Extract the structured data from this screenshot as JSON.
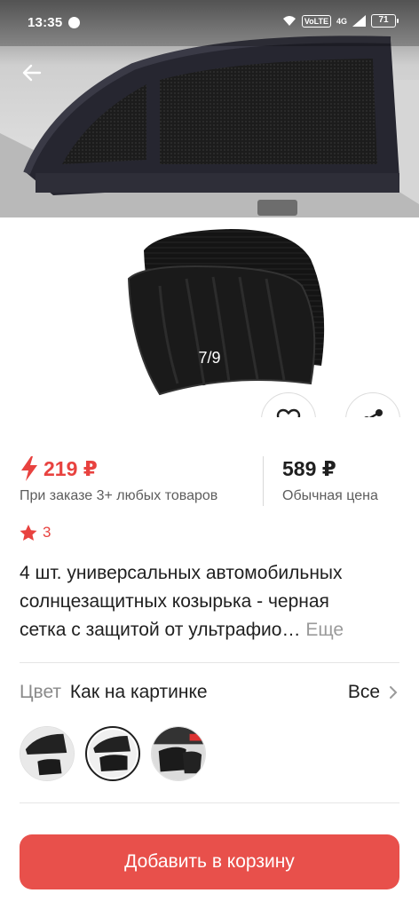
{
  "status_bar": {
    "time": "13:35",
    "volte": "VoLTE",
    "network": "4G",
    "battery": "71"
  },
  "gallery": {
    "counter": "7/9"
  },
  "price": {
    "promo_price": "219 ₽",
    "promo_note": "При заказе 3+ любых товаров",
    "regular_price": "589 ₽",
    "regular_note": "Обычная цена"
  },
  "rating": {
    "value": "3"
  },
  "product": {
    "title_lines": [
      "4 шт. универсальных автомобильных",
      "солнцезащитных козырька - черная",
      "сетка с защитой от ультрафио…"
    ],
    "more_label": "Еще"
  },
  "color": {
    "label": "Цвет",
    "value": "Как на картинке",
    "all_label": "Все"
  },
  "cart": {
    "button_label": "Добавить в корзину"
  },
  "colors": {
    "accent": "#e8423f",
    "button": "#e8504b"
  }
}
